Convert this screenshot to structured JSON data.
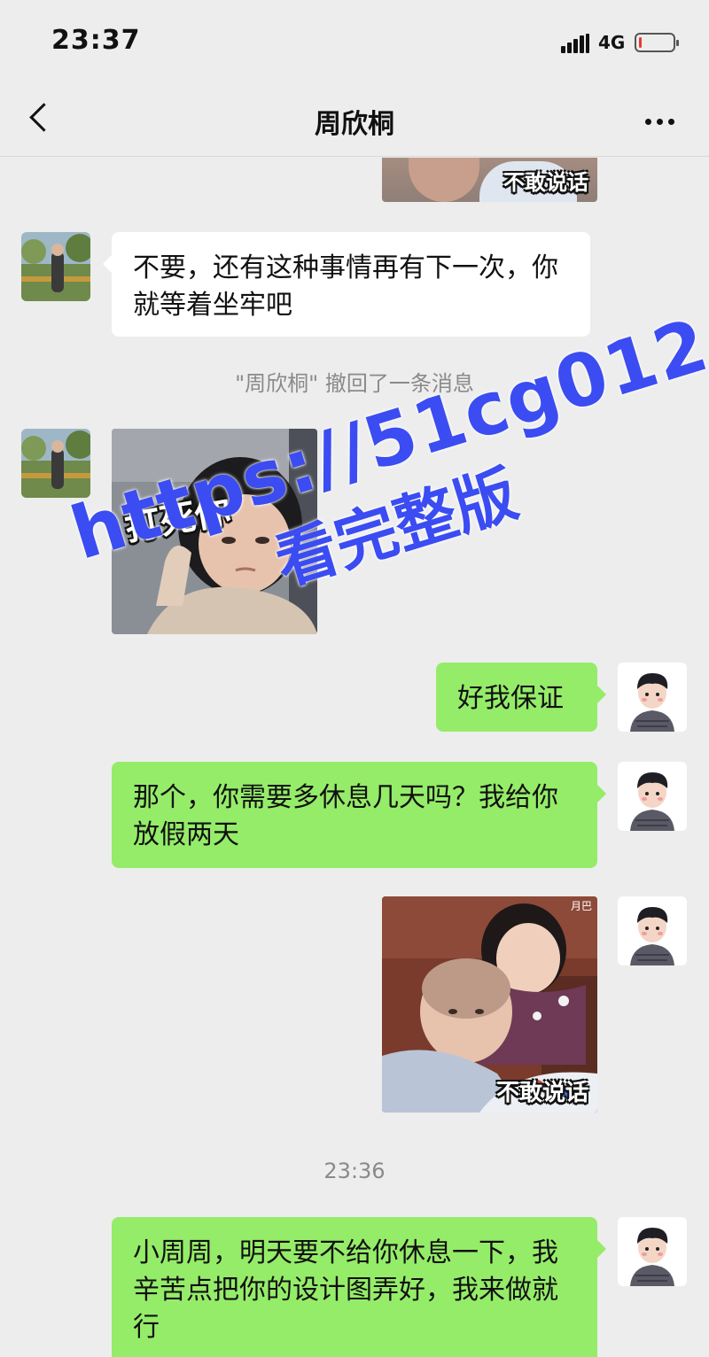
{
  "status_bar": {
    "time": "23:37",
    "network": "4G",
    "battery_level": 0.08,
    "battery_color": "#e23b2f"
  },
  "nav": {
    "title": "周欣桐",
    "back_icon": "chevron-left-icon",
    "more_icon": "ellipsis-icon"
  },
  "stickers": {
    "top_partial_caption": "不敢说话",
    "beat_caption": "打死你",
    "hug_caption": "不敢说话",
    "hug_corner_tag": "月巴"
  },
  "messages": {
    "m1": {
      "sender": "contact",
      "text": "不要，还有这种事情再有下一次，你就等着坐牢吧"
    },
    "recall_note": "\"周欣桐\" 撤回了一条消息",
    "m3": {
      "sender": "self",
      "text": "好我保证"
    },
    "m4": {
      "sender": "self",
      "text": "那个，你需要多休息几天吗？我给你放假两天"
    },
    "timestamp": "23:36",
    "m6": {
      "sender": "self",
      "text": "小周周，明天要不给你休息一下，我辛苦点把你的设计图弄好，我来做就行"
    }
  },
  "watermark": {
    "url": "https://51cg012.com",
    "tagline": "看完整版"
  },
  "colors": {
    "background": "#ededed",
    "self_bubble": "#95ec69",
    "contact_bubble": "#ffffff",
    "watermark": "#3b4cf2"
  }
}
